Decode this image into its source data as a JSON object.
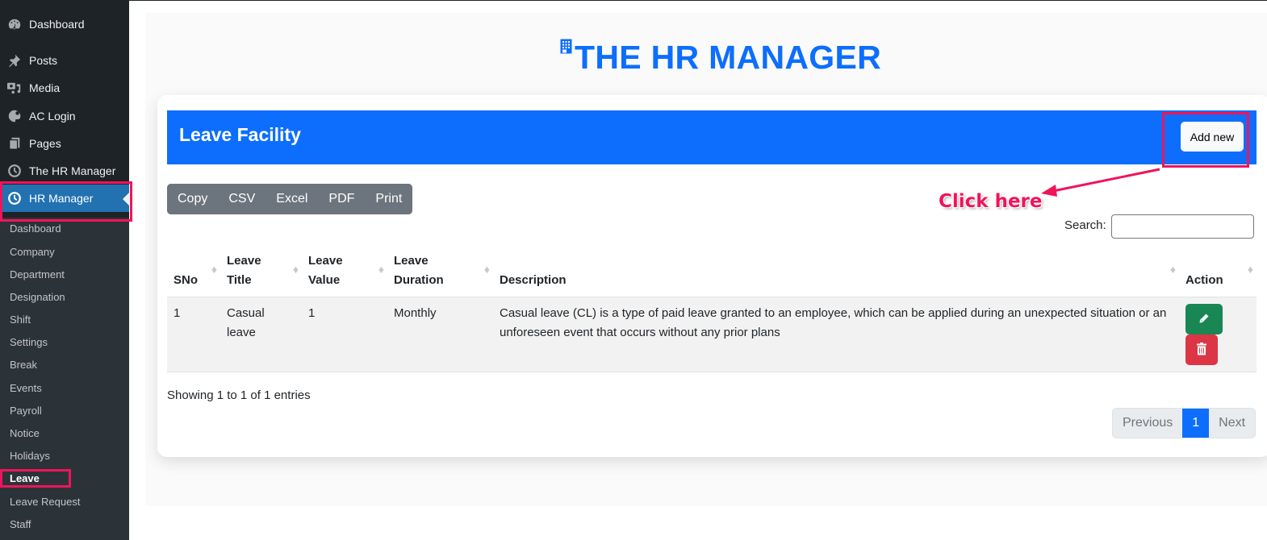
{
  "sidebar": {
    "items": [
      {
        "label": "Dashboard",
        "icon": "dashboard-icon"
      },
      {
        "label": "Posts",
        "icon": "pin-icon"
      },
      {
        "label": "Media",
        "icon": "media-icon"
      },
      {
        "label": "AC Login",
        "icon": "palette-icon"
      },
      {
        "label": "Pages",
        "icon": "pages-icon"
      },
      {
        "label": "The HR Manager",
        "icon": "clock-icon"
      },
      {
        "label": "HR Manager",
        "icon": "clock-icon",
        "active": true
      }
    ],
    "submenu": [
      "Dashboard",
      "Company",
      "Department",
      "Designation",
      "Shift",
      "Settings",
      "Break",
      "Events",
      "Payroll",
      "Notice",
      "Holidays",
      "Leave",
      "Leave Request",
      "Staff"
    ],
    "current_submenu": "Leave"
  },
  "header": {
    "title": "THE HR MANAGER",
    "brand_color": "#0d6efd"
  },
  "card": {
    "title": "Leave Facility",
    "add_button": "Add new",
    "export_buttons": [
      "Copy",
      "CSV",
      "Excel",
      "PDF",
      "Print"
    ],
    "search_label": "Search:",
    "search_value": ""
  },
  "table": {
    "columns": [
      "SNo",
      "Leave Title",
      "Leave Value",
      "Leave Duration",
      "Description",
      "Action"
    ],
    "rows": [
      {
        "sno": "1",
        "title": "Casual leave",
        "value": "1",
        "duration": "Monthly",
        "description": "Casual leave (CL) is a type of paid leave granted to an employee, which can be applied during an unexpected situation or an unforeseen event that occurs without any prior plans"
      }
    ]
  },
  "footer": {
    "info": "Showing 1 to 1 of 1 entries",
    "pagination": {
      "previous": "Previous",
      "current": "1",
      "next": "Next"
    }
  },
  "annotation": {
    "text": "Click here",
    "color": "#f0145a"
  }
}
